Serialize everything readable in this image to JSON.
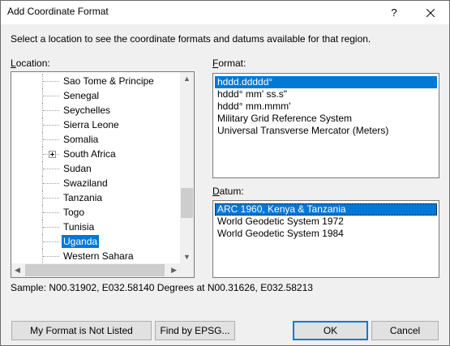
{
  "window": {
    "title": "Add Coordinate Format",
    "help_label": "?",
    "close_icon": "close-icon"
  },
  "instruction": "Select a location to see the coordinate formats and datums available for that region.",
  "location": {
    "label_access": "L",
    "label_rest": "ocation:",
    "items": [
      {
        "label": "Sao Tome & Principe",
        "expandable": false,
        "selected": false
      },
      {
        "label": "Senegal",
        "expandable": false,
        "selected": false
      },
      {
        "label": "Seychelles",
        "expandable": false,
        "selected": false
      },
      {
        "label": "Sierra Leone",
        "expandable": false,
        "selected": false
      },
      {
        "label": "Somalia",
        "expandable": false,
        "selected": false
      },
      {
        "label": "South Africa",
        "expandable": true,
        "selected": false
      },
      {
        "label": "Sudan",
        "expandable": false,
        "selected": false
      },
      {
        "label": "Swaziland",
        "expandable": false,
        "selected": false
      },
      {
        "label": "Tanzania",
        "expandable": false,
        "selected": false
      },
      {
        "label": "Togo",
        "expandable": false,
        "selected": false
      },
      {
        "label": "Tunisia",
        "expandable": false,
        "selected": false
      },
      {
        "label": "Uganda",
        "expandable": false,
        "selected": true
      },
      {
        "label": "Western Sahara",
        "expandable": false,
        "selected": false
      }
    ]
  },
  "format": {
    "label_access": "F",
    "label_rest": "ormat:",
    "items": [
      {
        "label": "hddd.ddddd°",
        "selected": true
      },
      {
        "label": "hddd° mm' ss.s\"",
        "selected": false
      },
      {
        "label": "hddd° mm.mmm'",
        "selected": false
      },
      {
        "label": "Military Grid Reference System",
        "selected": false
      },
      {
        "label": "Universal Transverse Mercator (Meters)",
        "selected": false
      }
    ]
  },
  "datum": {
    "label_access": "D",
    "label_rest": "atum:",
    "items": [
      {
        "label": "ARC 1960, Kenya & Tanzania",
        "selected": true
      },
      {
        "label": "World Geodetic System 1972",
        "selected": false
      },
      {
        "label": "World Geodetic System 1984",
        "selected": false
      }
    ]
  },
  "sample": "Sample: N00.31902, E032.58140 Degrees at N00.31626, E032.58213",
  "buttons": {
    "not_listed": "My Format is Not Listed",
    "find_epsg": "Find by EPSG...",
    "ok": "OK",
    "cancel": "Cancel"
  },
  "colors": {
    "selection": "#0078d7",
    "dialog_bg": "#f0f0f0"
  }
}
